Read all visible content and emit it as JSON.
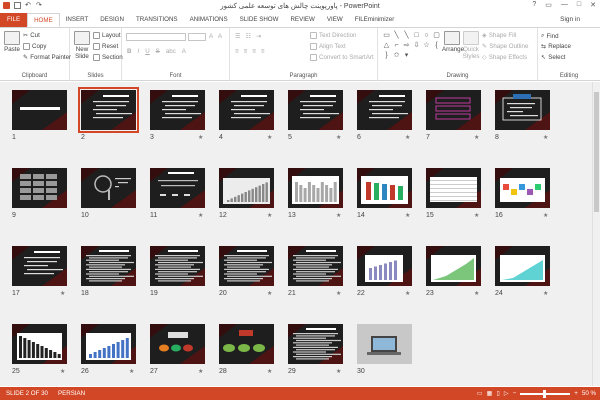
{
  "window": {
    "title": "پاورپوینت چالش های توسعه علمی کشور - PowerPoint",
    "controls": [
      "?",
      "▭",
      "—",
      "□",
      "✕"
    ]
  },
  "tabs": [
    "FILE",
    "HOME",
    "INSERT",
    "DESIGN",
    "TRANSITIONS",
    "ANIMATIONS",
    "SLIDE SHOW",
    "REVIEW",
    "VIEW",
    "FILEminimizer"
  ],
  "active_tab": "HOME",
  "sign_in": "Sign in",
  "ribbon": {
    "clipboard": {
      "label": "Clipboard",
      "paste": "Paste",
      "cut": "Cut",
      "copy": "Copy",
      "format_painter": "Format Painter"
    },
    "slides": {
      "label": "Slides",
      "new_slide": "New Slide",
      "layout": "Layout",
      "reset": "Reset",
      "section": "Section"
    },
    "font": {
      "label": "Font"
    },
    "paragraph": {
      "label": "Paragraph",
      "text_direction": "Text Direction",
      "align_text": "Align Text",
      "convert": "Convert to SmartArt"
    },
    "drawing": {
      "label": "Drawing",
      "arrange": "Arrange",
      "quick_styles": "Quick Styles",
      "shape_fill": "Shape Fill",
      "shape_outline": "Shape Outline",
      "shape_effects": "Shape Effects"
    },
    "editing": {
      "label": "Editing",
      "find": "Find",
      "replace": "Replace",
      "select": "Select"
    }
  },
  "slides": [
    {
      "num": "1",
      "kind": "title",
      "star": false
    },
    {
      "num": "2",
      "kind": "text",
      "star": false,
      "selected": true
    },
    {
      "num": "3",
      "kind": "text",
      "star": true
    },
    {
      "num": "4",
      "kind": "text",
      "star": true
    },
    {
      "num": "5",
      "kind": "text",
      "star": true
    },
    {
      "num": "6",
      "kind": "text",
      "star": true
    },
    {
      "num": "7",
      "kind": "magenta",
      "star": true
    },
    {
      "num": "8",
      "kind": "diagram",
      "star": true
    },
    {
      "num": "9",
      "kind": "grid",
      "star": false
    },
    {
      "num": "10",
      "kind": "chart",
      "star": false
    },
    {
      "num": "11",
      "kind": "table",
      "star": true
    },
    {
      "num": "12",
      "kind": "bars",
      "star": true
    },
    {
      "num": "13",
      "kind": "whitebars",
      "star": true
    },
    {
      "num": "14",
      "kind": "colorbars",
      "star": true
    },
    {
      "num": "15",
      "kind": "gridchart",
      "star": true
    },
    {
      "num": "16",
      "kind": "colorful",
      "star": true
    },
    {
      "num": "17",
      "kind": "text",
      "star": true
    },
    {
      "num": "18",
      "kind": "dense",
      "star": false
    },
    {
      "num": "19",
      "kind": "dense",
      "star": false
    },
    {
      "num": "20",
      "kind": "dense",
      "star": true
    },
    {
      "num": "21",
      "kind": "dense",
      "star": true
    },
    {
      "num": "22",
      "kind": "chartbox",
      "star": true
    },
    {
      "num": "23",
      "kind": "greenchart",
      "star": true
    },
    {
      "num": "24",
      "kind": "cyanchart",
      "star": true
    },
    {
      "num": "25",
      "kind": "decline",
      "star": true
    },
    {
      "num": "26",
      "kind": "bluebars",
      "star": true
    },
    {
      "num": "27",
      "kind": "process",
      "star": true
    },
    {
      "num": "28",
      "kind": "flow",
      "star": true
    },
    {
      "num": "29",
      "kind": "dense",
      "star": true
    },
    {
      "num": "30",
      "kind": "photo",
      "star": false
    }
  ],
  "status": {
    "slide": "SLIDE 2 OF 30",
    "language": "PERSIAN",
    "zoom": "50 %"
  },
  "colors": {
    "accent": "#d24726",
    "slide_bg": "#222222"
  }
}
